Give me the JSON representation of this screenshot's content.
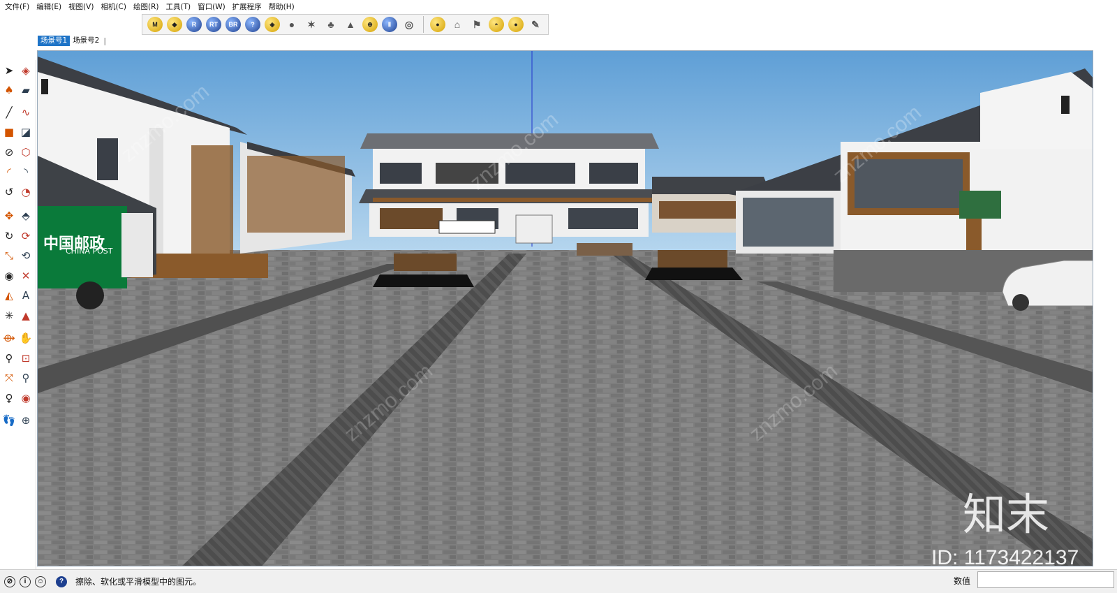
{
  "menu": [
    "文件(F)",
    "编辑(E)",
    "视图(V)",
    "相机(C)",
    "绘图(R)",
    "工具(T)",
    "窗口(W)",
    "扩展程序",
    "帮助(H)"
  ],
  "toolbar": {
    "buttons_group1": [
      {
        "icon": "m-badge-icon",
        "glyph": "M",
        "style": "gold"
      },
      {
        "icon": "tag-icon",
        "glyph": "◆",
        "style": "gold"
      },
      {
        "icon": "r-badge-icon",
        "glyph": "R",
        "style": "blue"
      },
      {
        "icon": "rt-badge-icon",
        "glyph": "RT",
        "style": "blue"
      },
      {
        "icon": "br-badge-icon",
        "glyph": "BR",
        "style": "blue"
      },
      {
        "icon": "help-circle-icon",
        "glyph": "?",
        "style": "blue"
      },
      {
        "icon": "label-icon",
        "glyph": "◈",
        "style": "gold"
      },
      {
        "icon": "sphere-icon",
        "glyph": "●",
        "style": "plain"
      },
      {
        "icon": "mesh-icon",
        "glyph": "✶",
        "style": "plain"
      },
      {
        "icon": "tree-icon",
        "glyph": "♣",
        "style": "plain"
      },
      {
        "icon": "landscape-icon",
        "glyph": "▲",
        "style": "plain"
      },
      {
        "icon": "target-icon",
        "glyph": "⊕",
        "style": "gold"
      },
      {
        "icon": "pause-icon",
        "glyph": "Ⅱ",
        "style": "blue"
      },
      {
        "icon": "color-wheel-icon",
        "glyph": "◎",
        "style": "plain"
      }
    ],
    "buttons_group2": [
      {
        "icon": "yellow-sphere-icon",
        "glyph": "●",
        "style": "gold"
      },
      {
        "icon": "lamp-icon",
        "glyph": "⌂",
        "style": "plain"
      },
      {
        "icon": "flag-icon",
        "glyph": "⚑",
        "style": "plain"
      },
      {
        "icon": "hemisphere-icon",
        "glyph": "◓",
        "style": "gold"
      },
      {
        "icon": "orb-icon",
        "glyph": "●",
        "style": "gold"
      },
      {
        "icon": "spotlight-icon",
        "glyph": "✎",
        "style": "plain"
      }
    ]
  },
  "scenes": [
    {
      "label": "场景号1",
      "active": true
    },
    {
      "label": "场景号2",
      "active": false
    }
  ],
  "left_tools": [
    {
      "icon": "select-arrow-icon",
      "glyph": "➤"
    },
    {
      "icon": "component-icon",
      "glyph": "◈"
    },
    {
      "icon": "paint-bucket-icon",
      "glyph": "♠"
    },
    {
      "icon": "eraser-icon",
      "glyph": "▰"
    },
    {
      "icon": "pencil-line-icon",
      "glyph": "╱"
    },
    {
      "icon": "freehand-icon",
      "glyph": "∿"
    },
    {
      "icon": "rectangle-icon",
      "glyph": "■"
    },
    {
      "icon": "rotated-rectangle-icon",
      "glyph": "◪"
    },
    {
      "icon": "circle-icon",
      "glyph": "⊘"
    },
    {
      "icon": "polygon-icon",
      "glyph": "⬡"
    },
    {
      "icon": "arc-icon",
      "glyph": "◜"
    },
    {
      "icon": "arc-2pt-icon",
      "glyph": "◝"
    },
    {
      "icon": "arc-3pt-icon",
      "glyph": "↺"
    },
    {
      "icon": "pie-icon",
      "glyph": "◔"
    },
    {
      "icon": "move-icon",
      "glyph": "✥"
    },
    {
      "icon": "push-pull-icon",
      "glyph": "⬘"
    },
    {
      "icon": "rotate-icon",
      "glyph": "↻"
    },
    {
      "icon": "follow-me-icon",
      "glyph": "⟳"
    },
    {
      "icon": "scale-icon",
      "glyph": "⤡"
    },
    {
      "icon": "offset-icon",
      "glyph": "⟲"
    },
    {
      "icon": "tape-measure-icon",
      "glyph": "◉"
    },
    {
      "icon": "dimension-icon",
      "glyph": "✕"
    },
    {
      "icon": "protractor-icon",
      "glyph": "◭"
    },
    {
      "icon": "text-icon",
      "glyph": "A"
    },
    {
      "icon": "axes-icon",
      "glyph": "✳"
    },
    {
      "icon": "3d-text-icon",
      "glyph": "▲"
    },
    {
      "icon": "orbit-icon",
      "glyph": "⟴"
    },
    {
      "icon": "pan-hand-icon",
      "glyph": "✋"
    },
    {
      "icon": "zoom-icon",
      "glyph": "⚲"
    },
    {
      "icon": "zoom-window-icon",
      "glyph": "⊡"
    },
    {
      "icon": "zoom-extents-icon",
      "glyph": "⤧"
    },
    {
      "icon": "previous-view-icon",
      "glyph": "⚲"
    },
    {
      "icon": "position-camera-icon",
      "glyph": "♀"
    },
    {
      "icon": "look-around-icon",
      "glyph": "◉"
    },
    {
      "icon": "walk-icon",
      "glyph": "👣"
    },
    {
      "icon": "section-plane-icon",
      "glyph": "⊕"
    }
  ],
  "viewport": {
    "truck_sign_cn": "中国邮政",
    "truck_sign_en": "CHINA POST",
    "watermark_brand": "知末",
    "watermark_id": "ID: 1173422137",
    "watermark_repeat": "znzmo.com",
    "colors": {
      "sky_top": "#5f9fd6",
      "sky_bottom": "#b6d6ee",
      "pavement": "#7c7c7c",
      "stripe": "#4a4a4a",
      "roof": "#3c3f45",
      "wall": "#f3f3f3",
      "wood": "#8a5a2b",
      "truck_green": "#0a7a3a"
    }
  },
  "status": {
    "text": "擦除、软化或平滑模型中的图元。",
    "measure_label": "数值",
    "measure_value": ""
  }
}
